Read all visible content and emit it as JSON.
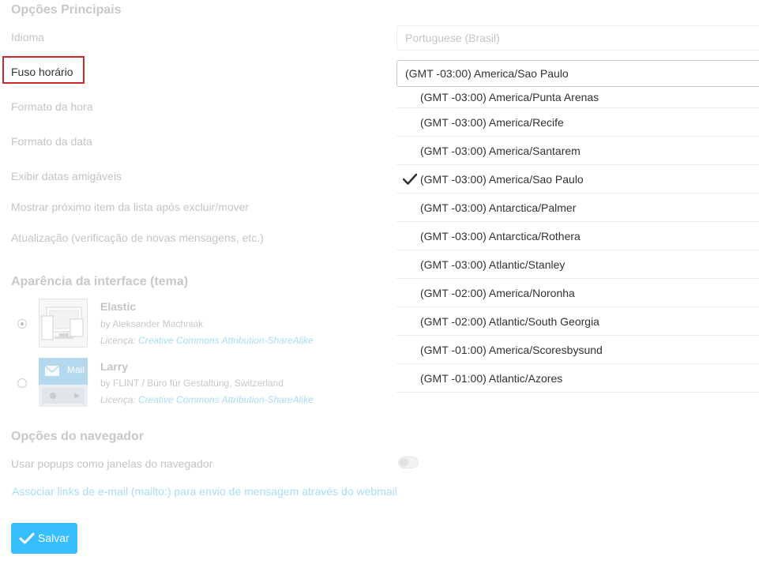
{
  "sections": {
    "main_options": "Opções Principais",
    "interface_appearance": "Aparência da interface (tema)",
    "browser_options": "Opções do navegador"
  },
  "labels": {
    "language": "Idioma",
    "timezone": "Fuso horário",
    "time_format": "Formato da hora",
    "date_format": "Formato da data",
    "friendly_dates": "Exibir datas amigáveis",
    "show_next": "Mostrar próximo item da lista após excluir/mover",
    "refresh": "Atualização (verificação de novas mensagens, etc.)",
    "popups": "Usar popups como janelas do navegador",
    "mailto": "Associar links de e-mail (mailto:) para envio de mensagem através do webmail"
  },
  "language_value": "Portuguese (Brasil)",
  "timezone_value": "(GMT -03:00) America/Sao Paulo",
  "timezone_options": [
    {
      "label": "(GMT -03:00) America/Punta Arenas",
      "selected": false
    },
    {
      "label": "(GMT -03:00) America/Recife",
      "selected": false
    },
    {
      "label": "(GMT -03:00) America/Santarem",
      "selected": false
    },
    {
      "label": "(GMT -03:00) America/Sao Paulo",
      "selected": true
    },
    {
      "label": "(GMT -03:00) Antarctica/Palmer",
      "selected": false
    },
    {
      "label": "(GMT -03:00) Antarctica/Rothera",
      "selected": false
    },
    {
      "label": "(GMT -03:00) Atlantic/Stanley",
      "selected": false
    },
    {
      "label": "(GMT -02:00) America/Noronha",
      "selected": false
    },
    {
      "label": "(GMT -02:00) Atlantic/South Georgia",
      "selected": false
    },
    {
      "label": "(GMT -01:00) America/Scoresbysund",
      "selected": false
    },
    {
      "label": "(GMT -01:00) Atlantic/Azores",
      "selected": false
    }
  ],
  "themes": [
    {
      "name": "Elastic",
      "author": "by Aleksander Machniak",
      "license_prefix": "Licença: ",
      "license_link": "Creative Commons Attribution-ShareAlike",
      "selected": true
    },
    {
      "name": "Larry",
      "author": "by FLINT / Büro für Gestaltung, Switzerland",
      "license_prefix": "Licença: ",
      "license_link": "Creative Commons Attribution-ShareAlike",
      "selected": false,
      "thumb_text": "Mail"
    }
  ],
  "save_label": "Salvar",
  "colors": {
    "accent": "#37beff",
    "highlight_border": "#cc2b2b",
    "link": "#a9dbf3"
  }
}
